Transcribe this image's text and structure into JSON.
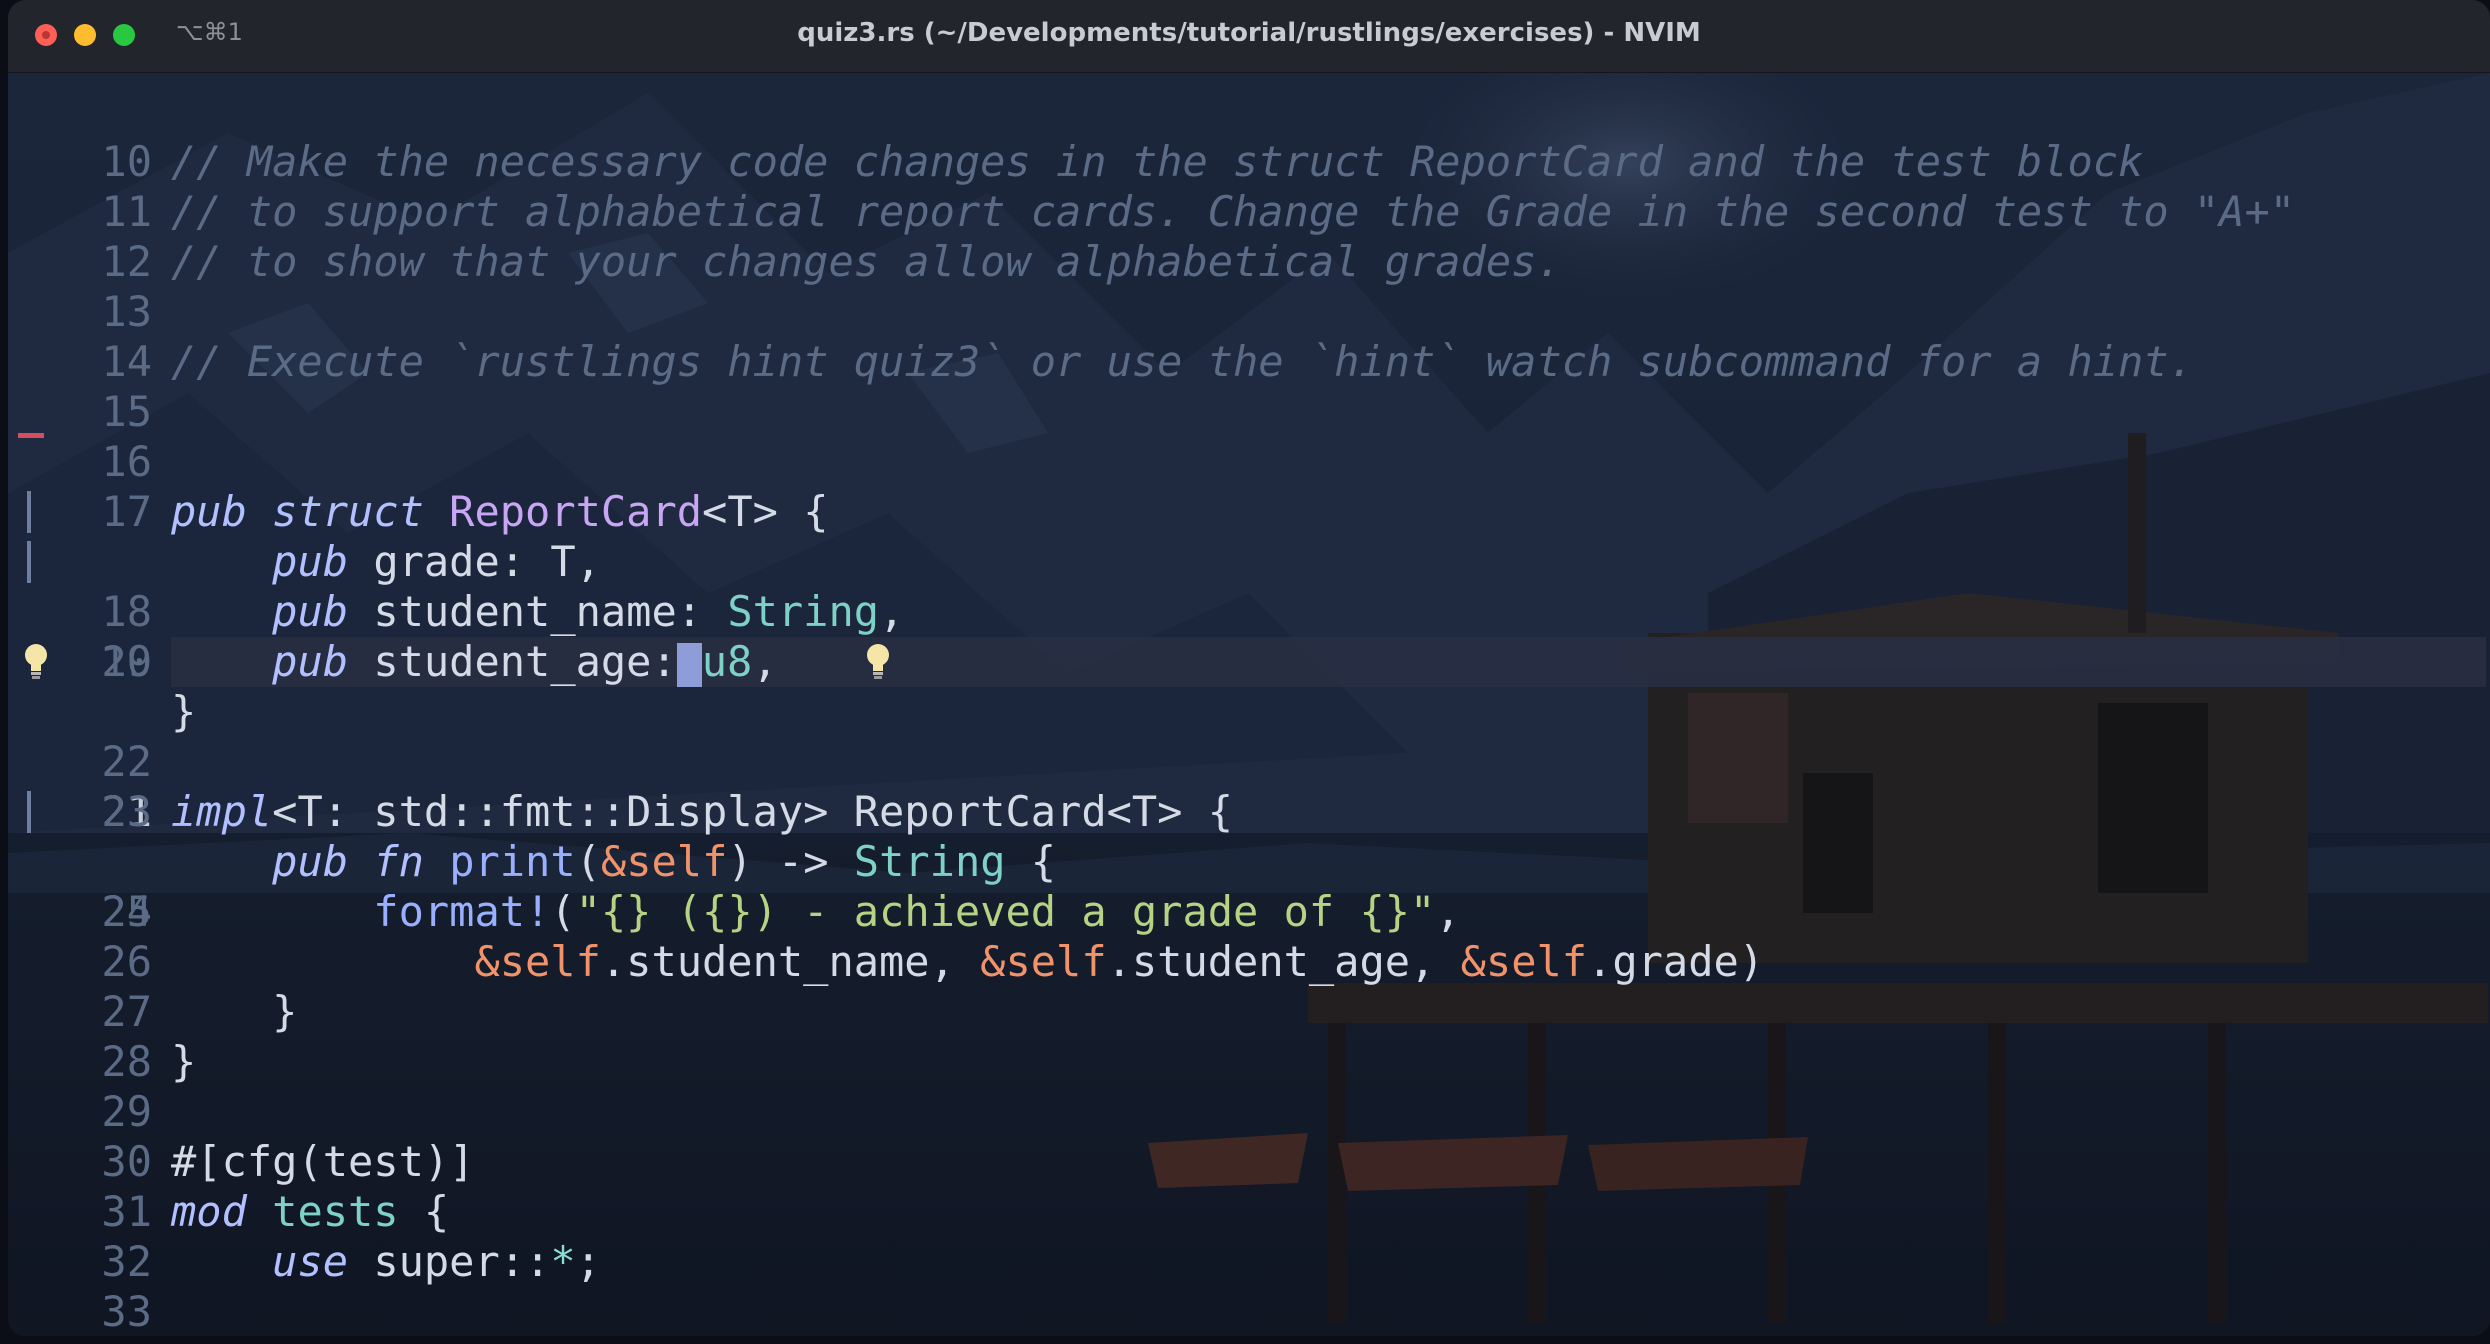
{
  "window": {
    "shortcut": "⌥⌘1",
    "title": "quiz3.rs (~/Developments/tutorial/rustlings/exercises) - NVIM"
  },
  "editor": {
    "current_line": "21",
    "lines": [
      {
        "num": "10",
        "text": ""
      },
      {
        "num": "11",
        "text": "// Make the necessary code changes in the struct ReportCard and the test block"
      },
      {
        "num": "12",
        "text": "// to support alphabetical report cards. Change the Grade in the second test to \"A+\""
      },
      {
        "num": "13",
        "text": "// to show that your changes allow alphabetical grades."
      },
      {
        "num": "14",
        "text": ""
      },
      {
        "num": "15",
        "text": "// Execute `rustlings hint quiz3` or use the `hint` watch subcommand for a hint."
      },
      {
        "num": "16",
        "text": ""
      },
      {
        "num": "17",
        "text": ""
      },
      {
        "num": "18",
        "t1": "pub",
        "t2": "struct",
        "t3": "ReportCard",
        "t4": "<T> {"
      },
      {
        "num": "19",
        "t1": "pub",
        "t2": "grade: T,"
      },
      {
        "num": "20",
        "t1": "pub",
        "t2": "student_name: ",
        "t3": "String",
        "t4": ","
      },
      {
        "num": "21",
        "t1": "pub",
        "t2": "student_age:",
        "t3": "u8",
        "t4": ","
      },
      {
        "num": "22",
        "t1": "}"
      },
      {
        "num": "23",
        "text": ""
      },
      {
        "num": "24",
        "t1": "impl",
        "t2": "<T: std::fmt::Display> ReportCard<T> {"
      },
      {
        "num": "25",
        "t1": "pub",
        "t2": "fn",
        "t3": "print",
        "t4": "(",
        "t5": "&self",
        "t6": ") -> ",
        "t7": "String",
        "t8": " {"
      },
      {
        "num": "26",
        "t1": "format!",
        "t2": "(",
        "t3": "\"{} ({}) - achieved a grade of {}\"",
        "t4": ","
      },
      {
        "num": "27",
        "t1": "&self",
        "t2": ".student_name, ",
        "t3": "&self",
        "t4": ".student_age, ",
        "t5": "&self",
        "t6": ".grade)"
      },
      {
        "num": "28",
        "t1": "}"
      },
      {
        "num": "29",
        "t1": "}"
      },
      {
        "num": "30",
        "text": ""
      },
      {
        "num": "31",
        "t1": "#[cfg(test)]"
      },
      {
        "num": "32",
        "t1": "mod",
        "t2": "tests",
        "t3": " {"
      },
      {
        "num": "33",
        "t1": "use",
        "t2": "super::",
        "t3": "*",
        "t4": ";"
      }
    ]
  },
  "icons": {
    "sign_bulb": "lightbulb-icon",
    "code_action": "lightbulb-icon"
  },
  "colors": {
    "comment": "#5b6b86",
    "keyword": "#b3c0ff",
    "type": "#c9a6f4",
    "builtin_type": "#7dd1c6",
    "string": "#b5d383",
    "self": "#f0936b",
    "git_change": "#6e7f9d",
    "git_delete": "#d44f5b"
  }
}
